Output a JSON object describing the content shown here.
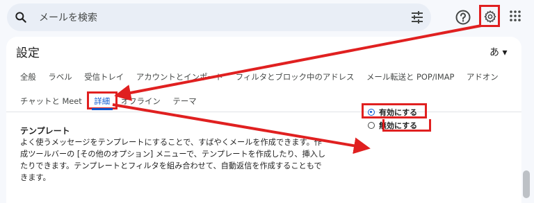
{
  "search": {
    "placeholder": "メールを検索"
  },
  "settings": {
    "title": "設定",
    "lang_button": "あ ▾",
    "tabs_row1": [
      "全般",
      "ラベル",
      "受信トレイ",
      "アカウントとインポート",
      "フィルタとブロック中のアドレス",
      "メール転送と POP/IMAP",
      "アドオン"
    ],
    "tabs_row2": [
      "チャットと Meet",
      "詳細",
      "オフライン",
      "テーマ"
    ],
    "active_tab": "詳細"
  },
  "template": {
    "title": "テンプレート",
    "description": "よく使うメッセージをテンプレートにすることで、すばやくメールを作成できます。作成ツールバーの [その他のオプション] メニューで、テンプレートを作成したり、挿入したりできます。テンプレートとフィルタを組み合わせて、自動返信を作成することもできます。",
    "enable_label": "有効にする",
    "disable_label": "無効にする",
    "selected": "有効にする"
  },
  "colors": {
    "highlight": "#e02020",
    "accent": "#0b57d0"
  },
  "icons": [
    "search-icon",
    "filter-icon",
    "help-icon",
    "gear-icon",
    "apps-icon"
  ]
}
